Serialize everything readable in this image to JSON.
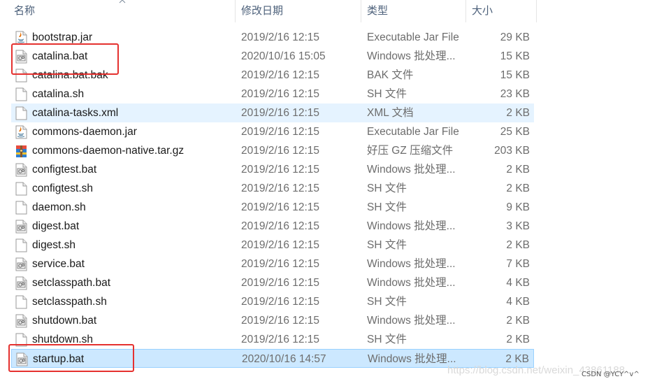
{
  "header": {
    "col_name": "名称",
    "col_date": "修改日期",
    "col_type": "类型",
    "col_size": "大小"
  },
  "files": [
    {
      "name": "bootstrap.jar",
      "date": "2019/2/16 12:15",
      "type": "Executable Jar File",
      "size": "29 KB",
      "icon": "jar-icon",
      "state": "normal"
    },
    {
      "name": "catalina.bat",
      "date": "2020/10/16 15:05",
      "type": "Windows 批处理...",
      "size": "15 KB",
      "icon": "bat-icon",
      "state": "normal"
    },
    {
      "name": "catalina.bat.bak",
      "date": "2019/2/16 12:15",
      "type": "BAK 文件",
      "size": "15 KB",
      "icon": "file-icon",
      "state": "normal"
    },
    {
      "name": "catalina.sh",
      "date": "2019/2/16 12:15",
      "type": "SH 文件",
      "size": "23 KB",
      "icon": "file-icon",
      "state": "normal"
    },
    {
      "name": "catalina-tasks.xml",
      "date": "2019/2/16 12:15",
      "type": "XML 文档",
      "size": "2 KB",
      "icon": "file-icon",
      "state": "hover"
    },
    {
      "name": "commons-daemon.jar",
      "date": "2019/2/16 12:15",
      "type": "Executable Jar File",
      "size": "25 KB",
      "icon": "jar-icon",
      "state": "normal"
    },
    {
      "name": "commons-daemon-native.tar.gz",
      "date": "2019/2/16 12:15",
      "type": "好压 GZ 压缩文件",
      "size": "203 KB",
      "icon": "archive-icon",
      "state": "normal"
    },
    {
      "name": "configtest.bat",
      "date": "2019/2/16 12:15",
      "type": "Windows 批处理...",
      "size": "2 KB",
      "icon": "bat-icon",
      "state": "normal"
    },
    {
      "name": "configtest.sh",
      "date": "2019/2/16 12:15",
      "type": "SH 文件",
      "size": "2 KB",
      "icon": "file-icon",
      "state": "normal"
    },
    {
      "name": "daemon.sh",
      "date": "2019/2/16 12:15",
      "type": "SH 文件",
      "size": "9 KB",
      "icon": "file-icon",
      "state": "normal"
    },
    {
      "name": "digest.bat",
      "date": "2019/2/16 12:15",
      "type": "Windows 批处理...",
      "size": "3 KB",
      "icon": "bat-icon",
      "state": "normal"
    },
    {
      "name": "digest.sh",
      "date": "2019/2/16 12:15",
      "type": "SH 文件",
      "size": "2 KB",
      "icon": "file-icon",
      "state": "normal"
    },
    {
      "name": "service.bat",
      "date": "2019/2/16 12:15",
      "type": "Windows 批处理...",
      "size": "7 KB",
      "icon": "bat-icon",
      "state": "normal"
    },
    {
      "name": "setclasspath.bat",
      "date": "2019/2/16 12:15",
      "type": "Windows 批处理...",
      "size": "4 KB",
      "icon": "bat-icon",
      "state": "normal"
    },
    {
      "name": "setclasspath.sh",
      "date": "2019/2/16 12:15",
      "type": "SH 文件",
      "size": "4 KB",
      "icon": "file-icon",
      "state": "normal"
    },
    {
      "name": "shutdown.bat",
      "date": "2019/2/16 12:15",
      "type": "Windows 批处理...",
      "size": "2 KB",
      "icon": "bat-icon",
      "state": "normal"
    },
    {
      "name": "shutdown.sh",
      "date": "2019/2/16 12:15",
      "type": "SH 文件",
      "size": "2 KB",
      "icon": "file-icon",
      "state": "normal"
    },
    {
      "name": "startup.bat",
      "date": "2020/10/16 14:57",
      "type": "Windows 批处理...",
      "size": "2 KB",
      "icon": "bat-icon",
      "state": "selected"
    }
  ],
  "highlight_color": "#e5312f",
  "selection_color": "#cce8ff",
  "hover_color": "#e5f3ff",
  "watermark": "CSDN @YCY^v^",
  "watermark_url": "https://blog.csdn.net/weixin_43861188"
}
